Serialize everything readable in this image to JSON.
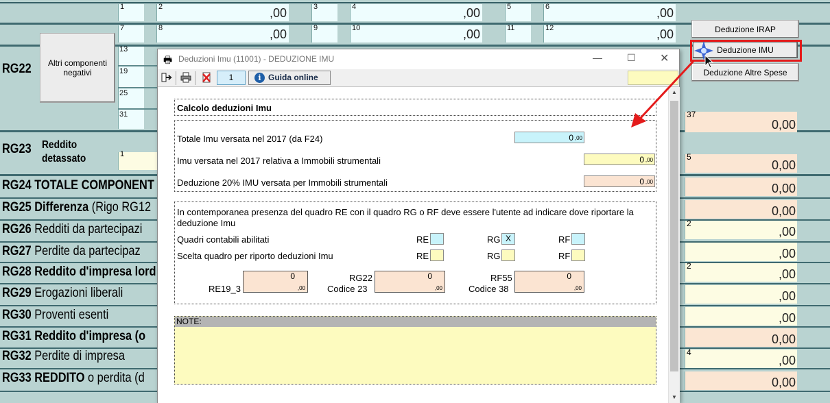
{
  "background_form": {
    "top_rows": [
      [
        {
          "num": "1",
          "val": ""
        },
        {
          "num": "2",
          "val": ",00"
        },
        {
          "num": "3",
          "val": ""
        },
        {
          "num": "4",
          "val": ",00"
        },
        {
          "num": "5",
          "val": ""
        },
        {
          "num": "6",
          "val": ",00"
        }
      ],
      [
        {
          "num": "7",
          "val": ""
        },
        {
          "num": "8",
          "val": ",00"
        },
        {
          "num": "9",
          "val": ""
        },
        {
          "num": "10",
          "val": ",00"
        },
        {
          "num": "11",
          "val": ""
        },
        {
          "num": "12",
          "val": ",00"
        }
      ]
    ],
    "left_nums": [
      "13",
      "19",
      "25",
      "31"
    ],
    "altri_button": "Altri componenti negativi",
    "rows": {
      "rg22": "RG22",
      "rg23_code": "RG23",
      "rg23_text": "Reddito detassato",
      "rg23_cell_num": "1",
      "rg24": "RG24 TOTALE COMPONENT",
      "rg25_code": "RG25 Differenza",
      "rg25_thin": " (Rigo RG12",
      "rg26_code": "RG26",
      "rg26_thin": " Redditi da partecipazi",
      "rg27_code": "RG27",
      "rg27_thin": " Perdite da partecipaz",
      "rg28": "RG28 Reddito d'impresa lord",
      "rg29_code": "RG29",
      "rg29_thin": " Erogazioni liberali",
      "rg30_code": "RG30",
      "rg30_thin": " Proventi esenti",
      "rg31": "RG31 Reddito d'impresa (o",
      "rg32_code": "RG32",
      "rg32_thin": " Perdite di impresa",
      "rg33_code": "RG33 REDDITO",
      "rg33_thin": " o perdita (d"
    },
    "right_cells": [
      {
        "num": "37",
        "val": "0,00"
      },
      {
        "num": "5",
        "val": "0,00"
      },
      {
        "num": "",
        "val": "0,00"
      },
      {
        "num": "",
        "val": "0,00"
      },
      {
        "num": "2",
        "val": ",00"
      },
      {
        "num": "",
        "val": ",00"
      },
      {
        "num": "2",
        "val": ",00"
      },
      {
        "num": "",
        "val": ",00"
      },
      {
        "num": "",
        "val": ",00"
      },
      {
        "num": "",
        "val": "0,00"
      },
      {
        "num": "4",
        "val": ",00"
      },
      {
        "num": "",
        "val": "0,00"
      }
    ]
  },
  "right_buttons": {
    "irap": "Deduzione IRAP",
    "imu": "Deduzione IMU",
    "altre": "Deduzione Altre Spese"
  },
  "colors": {
    "highlight": "#e41b1b"
  },
  "dialog": {
    "title": "Deduzioni Imu (11001) - DEDUZIONE IMU",
    "toolbar": {
      "page": "1",
      "guide": "Guida online"
    },
    "header": "Calcolo deduzioni Imu",
    "rows": [
      {
        "label": "Totale Imu versata nel 2017 (da F24)",
        "value": "0",
        "dec": ",00"
      },
      {
        "label": "Imu versata nel 2017 relativa a Immobili strumentali",
        "value": "0",
        "dec": ",00"
      },
      {
        "label": "Deduzione 20% IMU versata per Immobili strumentali",
        "value": "0",
        "dec": ",00"
      }
    ],
    "info": "In contemporanea presenza del quadro RE con il quadro RG o RF deve essere l'utente ad indicare dove riportare la deduzione Imu",
    "abilitati_label": "Quadri contabili abilitati",
    "scelta_label": "Scelta quadro per riporto deduzioni Imu",
    "re": "RE",
    "rg": "RG",
    "rf": "RF",
    "rg_checked": "X",
    "boxes": [
      {
        "top": "",
        "bottom": "RE19_3",
        "value": "0",
        "dec": ",00"
      },
      {
        "top": "RG22",
        "bottom": "Codice 23",
        "value": "0",
        "dec": ",00"
      },
      {
        "top": "RF55",
        "bottom": "Codice 38",
        "value": "0",
        "dec": ",00"
      }
    ],
    "note_label": "NOTE:"
  }
}
